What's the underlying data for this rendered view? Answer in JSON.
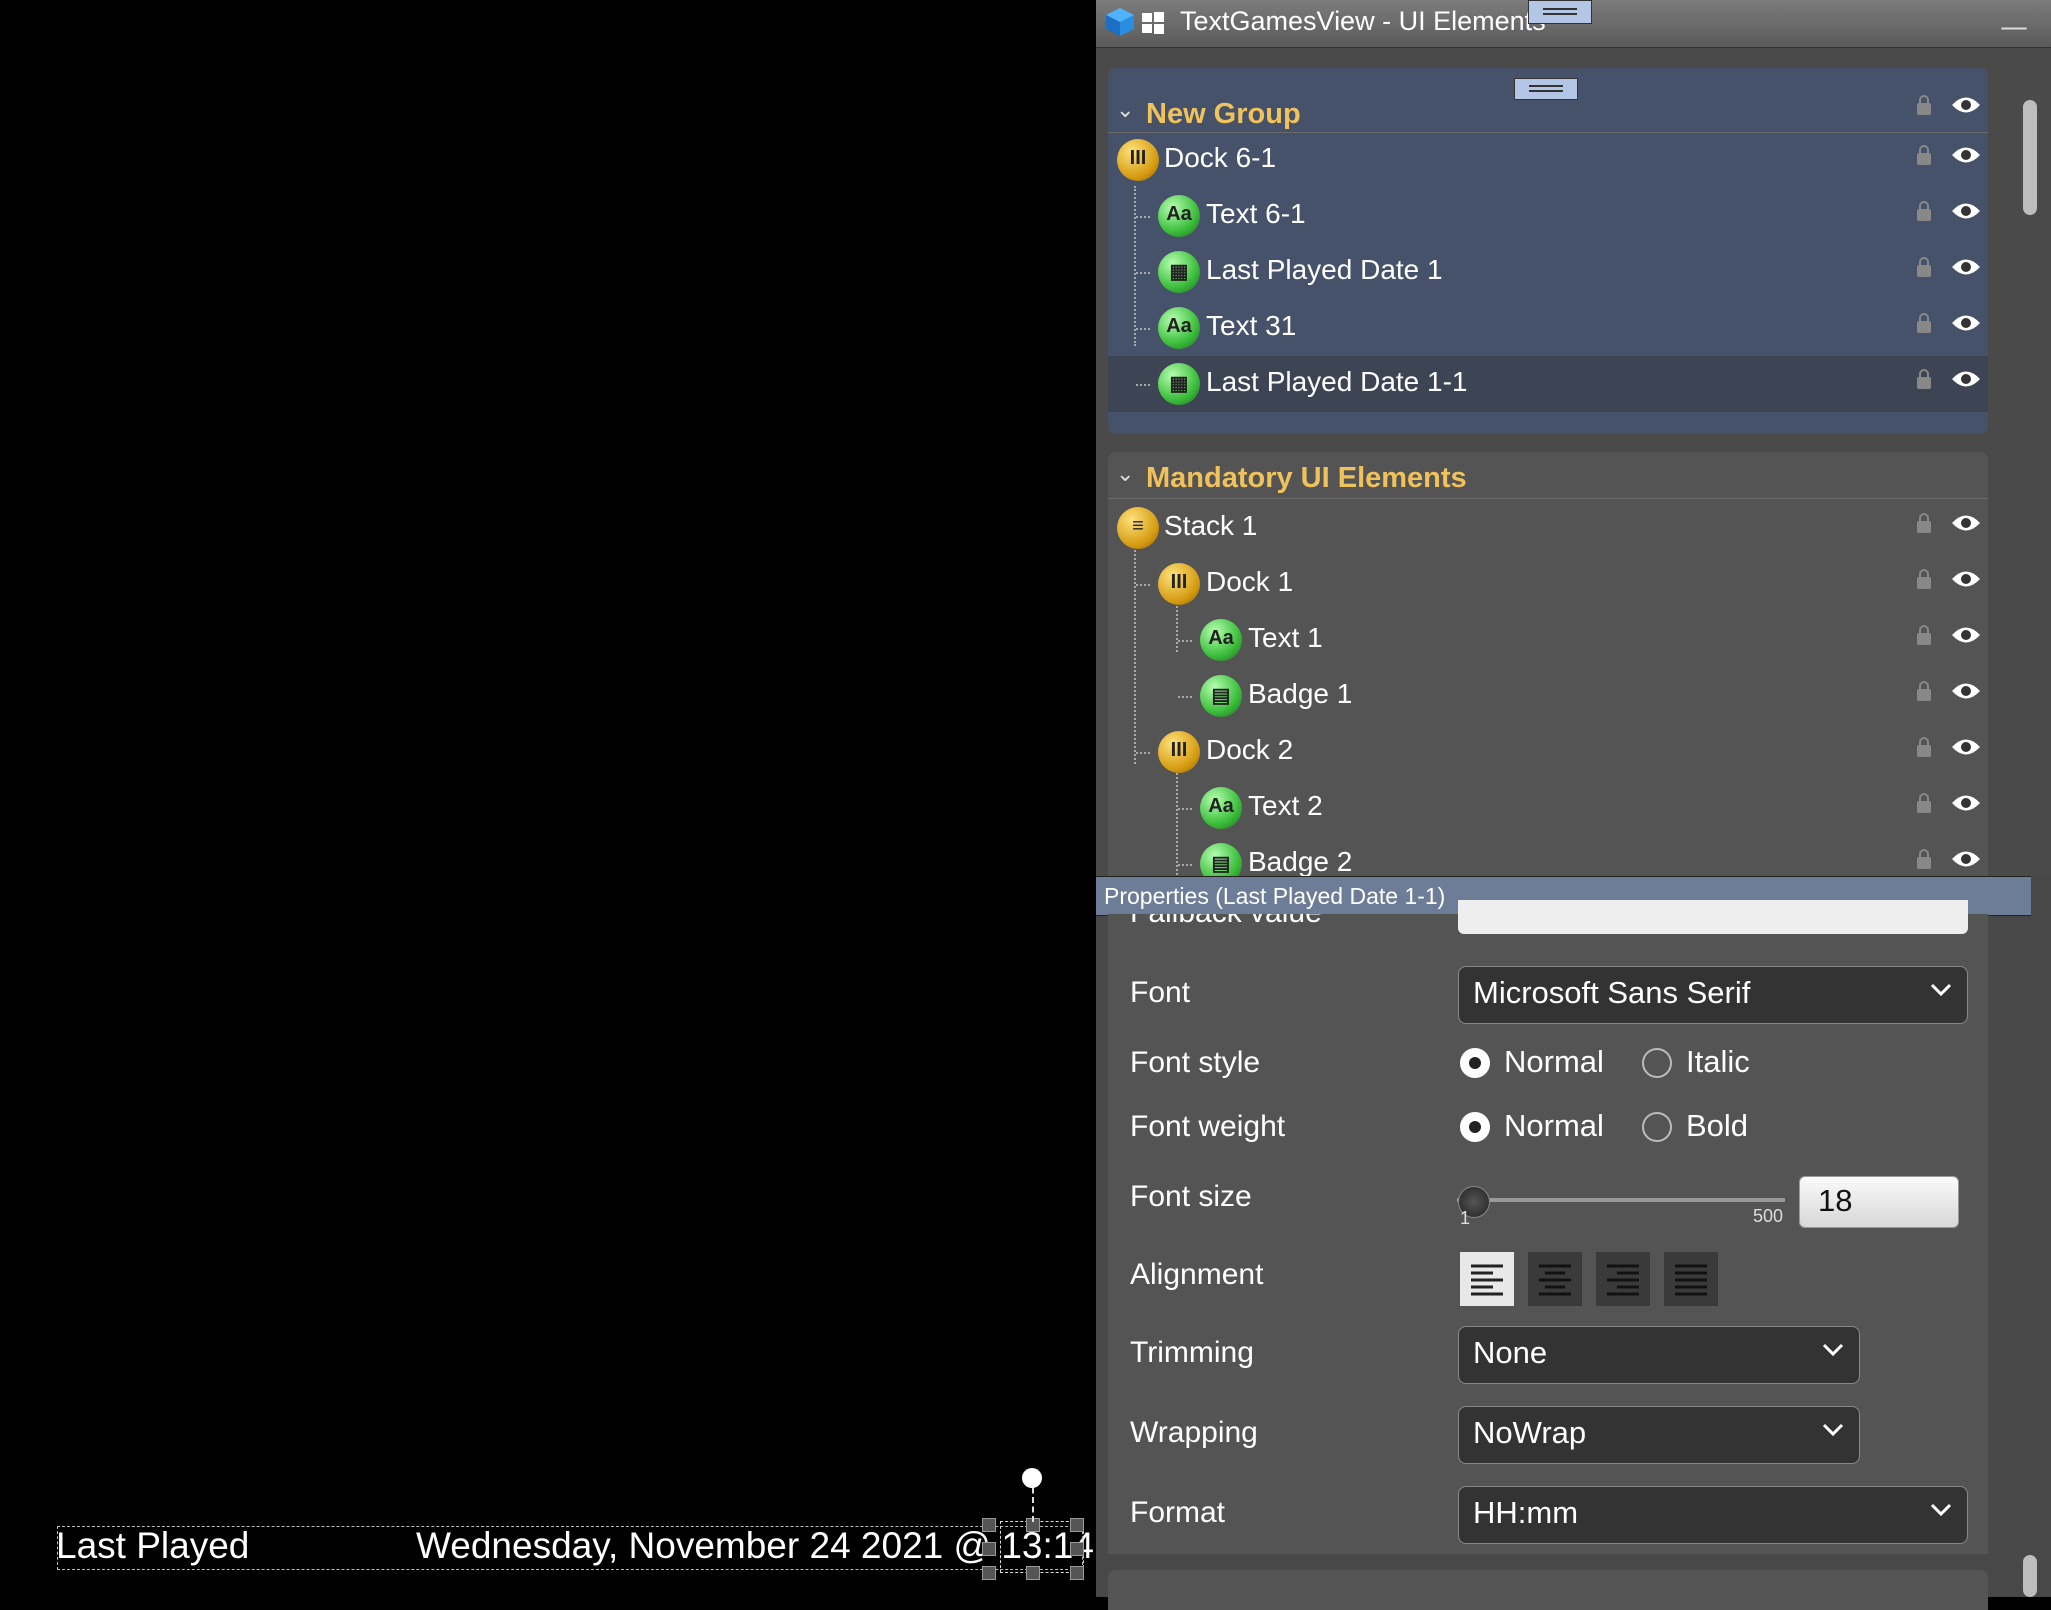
{
  "canvas": {
    "label_left": "Last Played",
    "label_right": "Wednesday, November 24 2021 @ 13:14"
  },
  "window": {
    "title": "TextGamesView - UI Elements",
    "minimize": "—"
  },
  "groups": [
    {
      "title": "New Group",
      "items": [
        {
          "label": "Dock 6-1",
          "icon": "dock-icon"
        },
        {
          "label": "Text 6-1",
          "icon": "text-icon",
          "glyph": "Aa"
        },
        {
          "label": "Last Played Date 1",
          "icon": "calendar-icon"
        },
        {
          "label": "Text 31",
          "icon": "text-icon",
          "glyph": "Aa"
        },
        {
          "label": "Last Played Date 1-1",
          "icon": "calendar-icon",
          "selected": true
        }
      ]
    },
    {
      "title": "Mandatory UI Elements",
      "items": [
        {
          "label": "Stack 1",
          "icon": "stack-icon"
        },
        {
          "label": "Dock 1",
          "icon": "dock-icon"
        },
        {
          "label": "Text 1",
          "icon": "text-icon",
          "glyph": "Aa"
        },
        {
          "label": "Badge 1",
          "icon": "badge-icon"
        },
        {
          "label": "Dock 2",
          "icon": "dock-icon"
        },
        {
          "label": "Text 2",
          "icon": "text-icon",
          "glyph": "Aa"
        },
        {
          "label": "Badge 2",
          "icon": "badge-icon"
        }
      ]
    }
  ],
  "properties": {
    "header": "Properties (Last Played Date 1-1)",
    "fallback_label": "Fallback value",
    "font_label": "Font",
    "font_value": "Microsoft Sans Serif",
    "font_style_label": "Font style",
    "font_style_normal": "Normal",
    "font_style_italic": "Italic",
    "font_weight_label": "Font weight",
    "font_weight_normal": "Normal",
    "font_weight_bold": "Bold",
    "font_size_label": "Font size",
    "font_size_min": "1",
    "font_size_max": "500",
    "font_size_value": "18",
    "alignment_label": "Alignment",
    "trimming_label": "Trimming",
    "trimming_value": "None",
    "wrapping_label": "Wrapping",
    "wrapping_value": "NoWrap",
    "format_label": "Format",
    "format_value": "HH:mm"
  },
  "colors": {
    "group_title": "#f0c25b",
    "selected_group_bg": "#46526a",
    "properties_header": "#6d7d97"
  }
}
